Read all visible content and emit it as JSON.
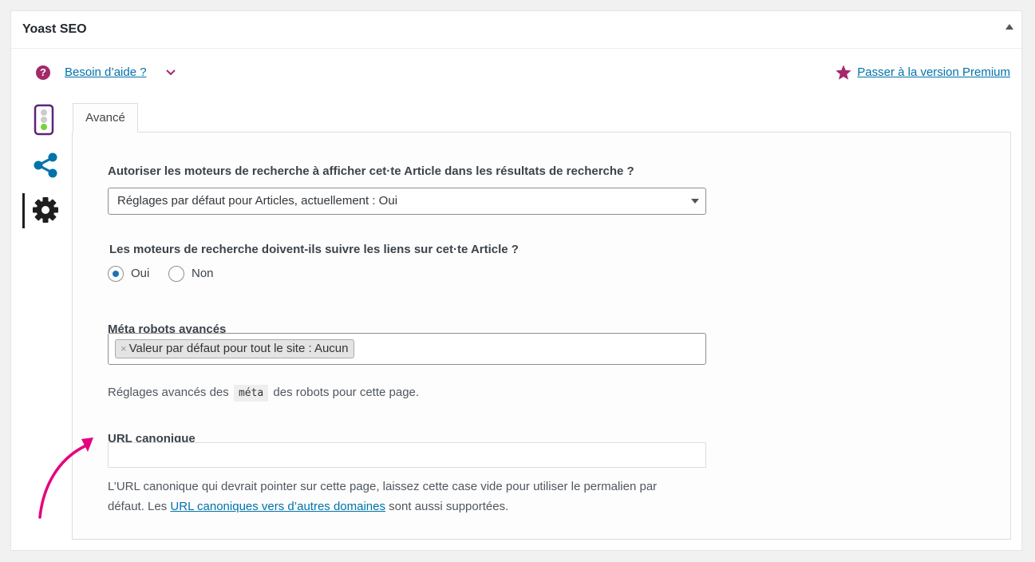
{
  "metabox": {
    "title": "Yoast SEO"
  },
  "help": {
    "link_label": "Besoin d’aide ?"
  },
  "premium": {
    "link_label": "Passer à la version Premium"
  },
  "side_tabs": [
    {
      "name": "readability",
      "icon": "traffic-light-icon"
    },
    {
      "name": "social",
      "icon": "share-icon"
    },
    {
      "name": "advanced",
      "icon": "gear-icon",
      "active": true
    }
  ],
  "tabs": [
    {
      "label": "Avancé",
      "active": true
    }
  ],
  "form": {
    "allow_search_label": "Autoriser les moteurs de recherche à afficher cet·te Article dans les résultats de recherche ?",
    "allow_search_value": "Réglages par défaut pour Articles, actuellement : Oui",
    "follow_links_label": "Les moteurs de recherche doivent-ils suivre les liens sur cet·te Article ?",
    "follow_options": [
      {
        "label": "Oui",
        "checked": true
      },
      {
        "label": "Non",
        "checked": false
      }
    ],
    "meta_robots_label": "Méta robots avancés",
    "meta_robots_chip": "Valeur par défaut pour tout le site : Aucun",
    "meta_robots_chip_remove": "×",
    "meta_robots_desc_before": "Réglages avancés des",
    "meta_robots_desc_code": "méta",
    "meta_robots_desc_after": "des robots pour cette page.",
    "canonical_label": "URL canonique",
    "canonical_value": "",
    "canonical_desc_line1": "L’URL canonique qui devrait pointer sur cette page, laissez cette case vide pour utiliser le permalien par",
    "canonical_desc_before_link": "défaut. Les",
    "canonical_desc_link": "URL canoniques vers d’autres domaines",
    "canonical_desc_after_link": "sont aussi supportées."
  },
  "colors": {
    "yoast_purple": "#a4286a",
    "link_blue": "#0073aa",
    "annotation_pink": "#e6007e",
    "radio_blue": "#2271b1"
  }
}
